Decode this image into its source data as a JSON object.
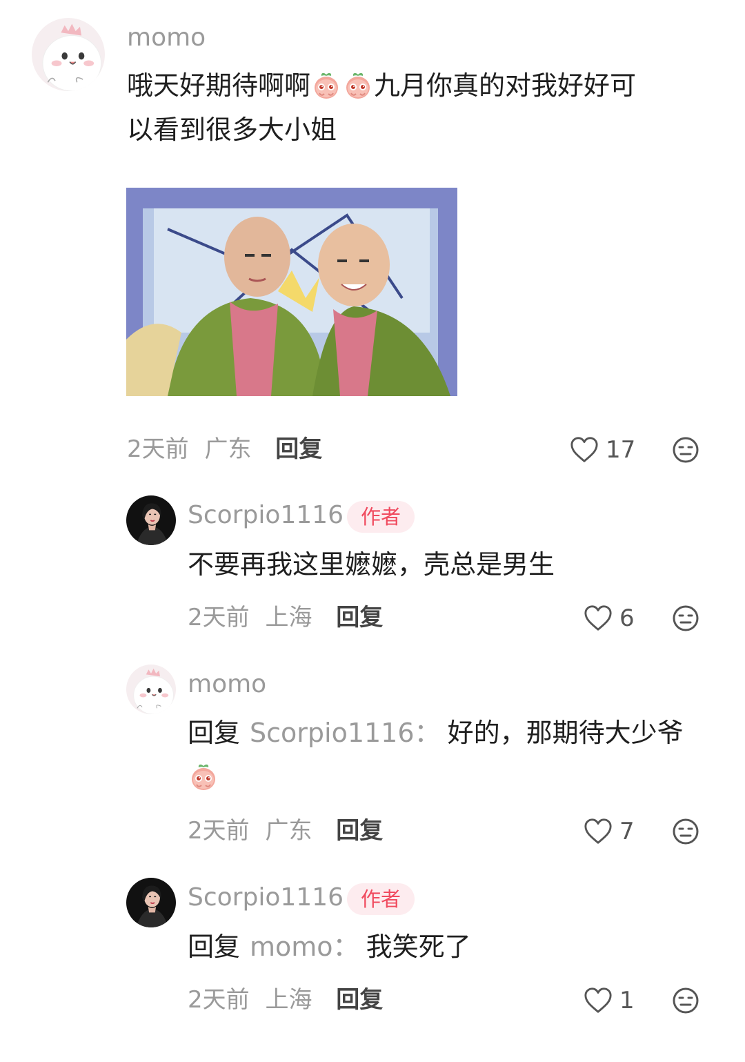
{
  "comments": [
    {
      "username": "momo",
      "text_a": "哦天好期待啊啊",
      "text_b": "九月你真的对我好好可",
      "text_c": "以看到很多大小姐",
      "emojis": [
        "peach-crying-emoji",
        "peach-crying-emoji"
      ],
      "image": "meme-photo-two-men-qing-costume",
      "time": "2天前",
      "location": "广东",
      "reply_label": "回复",
      "likes": "17",
      "avatar": "cartoon-dumpling-avatar"
    },
    {
      "username": "Scorpio1116",
      "badge": "作者",
      "text": "不要再我这里嬷嬷，壳总是男生",
      "time": "2天前",
      "location": "上海",
      "reply_label": "回复",
      "likes": "6",
      "avatar": "portrait-woman-avatar"
    },
    {
      "username": "momo",
      "reply_prefix": "回复",
      "reply_target": "Scorpio1116",
      "reply_colon": "：",
      "text": "好的，那期待大少爷",
      "emojis": [
        "peach-crying-emoji"
      ],
      "time": "2天前",
      "location": "广东",
      "reply_label": "回复",
      "likes": "7",
      "avatar": "cartoon-dumpling-avatar"
    },
    {
      "username": "Scorpio1116",
      "badge": "作者",
      "reply_prefix": "回复",
      "reply_target": "momo",
      "reply_colon": "：",
      "text": "我笑死了",
      "time": "2天前",
      "location": "上海",
      "reply_label": "回复",
      "likes": "1",
      "avatar": "portrait-woman-avatar"
    }
  ],
  "colors": {
    "muted": "#9a9a9a",
    "author_badge_bg": "#fdecef",
    "author_badge_text": "#f04a5e"
  }
}
